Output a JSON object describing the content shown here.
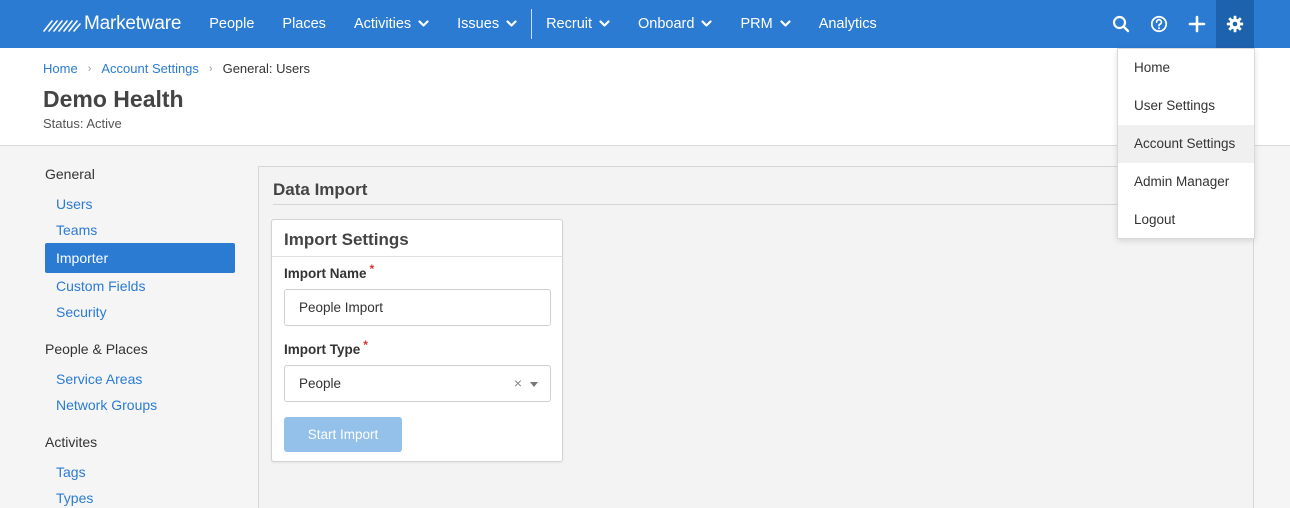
{
  "brand": {
    "name": "Marketware"
  },
  "nav": {
    "items": [
      {
        "label": "People",
        "has_menu": false
      },
      {
        "label": "Places",
        "has_menu": false
      },
      {
        "label": "Activities",
        "has_menu": true
      },
      {
        "label": "Issues",
        "has_menu": true
      },
      {
        "label": "Recruit",
        "has_menu": true
      },
      {
        "label": "Onboard",
        "has_menu": true
      },
      {
        "label": "PRM",
        "has_menu": true
      },
      {
        "label": "Analytics",
        "has_menu": false
      }
    ],
    "icons": [
      "search-icon",
      "help-icon",
      "plus-icon",
      "gear-icon"
    ]
  },
  "breadcrumb": [
    {
      "label": "Home"
    },
    {
      "label": "Account Settings"
    },
    {
      "label": "General: Users"
    }
  ],
  "header": {
    "title": "Demo Health",
    "status": "Status: Active"
  },
  "sidebar": {
    "groups": [
      {
        "title": "General",
        "items": [
          "Users",
          "Teams",
          "Importer",
          "Custom Fields",
          "Security"
        ]
      },
      {
        "title": "People & Places",
        "items": [
          "Service Areas",
          "Network Groups"
        ]
      },
      {
        "title": "Activites",
        "items": [
          "Tags",
          "Types"
        ]
      }
    ],
    "active_item": "Importer"
  },
  "main": {
    "title": "Data Import",
    "card": {
      "title": "Import Settings",
      "import_name_label": "Import Name",
      "import_name_value": "People Import",
      "import_type_label": "Import Type",
      "import_type_value": "People",
      "required_mark": "*",
      "clear_glyph": "×",
      "submit_label": "Start Import"
    }
  },
  "settings_menu": {
    "items": [
      "Home",
      "User Settings",
      "Account Settings",
      "Admin Manager",
      "Logout"
    ],
    "hovered": "Account Settings"
  },
  "colors": {
    "primary": "#2b7bd3",
    "nav_active": "#1d62ad",
    "button_disabled": "#93c1ea",
    "required": "#dd3333"
  }
}
